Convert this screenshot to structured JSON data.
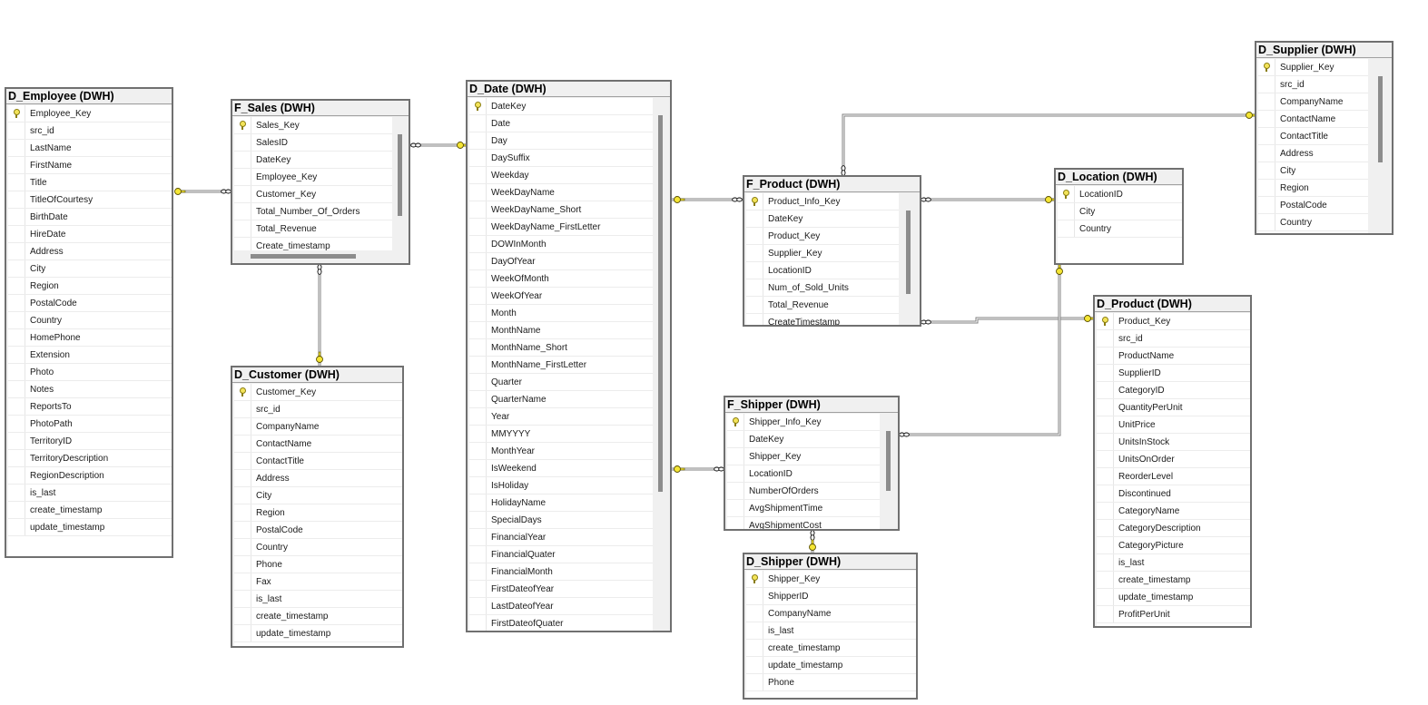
{
  "diagram": {
    "tables": {
      "d_employee": {
        "title": "D_Employee (DWH)",
        "primary_key": "Employee_Key",
        "columns": [
          "Employee_Key",
          "src_id",
          "LastName",
          "FirstName",
          "Title",
          "TitleOfCourtesy",
          "BirthDate",
          "HireDate",
          "Address",
          "City",
          "Region",
          "PostalCode",
          "Country",
          "HomePhone",
          "Extension",
          "Photo",
          "Notes",
          "ReportsTo",
          "PhotoPath",
          "TerritoryID",
          "TerritoryDescription",
          "RegionDescription",
          "is_last",
          "create_timestamp",
          "update_timestamp"
        ]
      },
      "f_sales": {
        "title": "F_Sales (DWH)",
        "primary_key": "Sales_Key",
        "columns": [
          "Sales_Key",
          "SalesID",
          "DateKey",
          "Employee_Key",
          "Customer_Key",
          "Total_Number_Of_Orders",
          "Total_Revenue",
          "Create_timestamp"
        ]
      },
      "d_customer": {
        "title": "D_Customer (DWH)",
        "primary_key": "Customer_Key",
        "columns": [
          "Customer_Key",
          "src_id",
          "CompanyName",
          "ContactName",
          "ContactTitle",
          "Address",
          "City",
          "Region",
          "PostalCode",
          "Country",
          "Phone",
          "Fax",
          "is_last",
          "create_timestamp",
          "update_timestamp"
        ]
      },
      "d_date": {
        "title": "D_Date (DWH)",
        "primary_key": "DateKey",
        "columns": [
          "DateKey",
          "Date",
          "Day",
          "DaySuffix",
          "Weekday",
          "WeekDayName",
          "WeekDayName_Short",
          "WeekDayName_FirstLetter",
          "DOWInMonth",
          "DayOfYear",
          "WeekOfMonth",
          "WeekOfYear",
          "Month",
          "MonthName",
          "MonthName_Short",
          "MonthName_FirstLetter",
          "Quarter",
          "QuarterName",
          "Year",
          "MMYYYY",
          "MonthYear",
          "IsWeekend",
          "IsHoliday",
          "HolidayName",
          "SpecialDays",
          "FinancialYear",
          "FinancialQuater",
          "FinancialMonth",
          "FirstDateofYear",
          "LastDateofYear",
          "FirstDateofQuater"
        ]
      },
      "f_product": {
        "title": "F_Product (DWH)",
        "primary_key": "Product_Info_Key",
        "columns": [
          "Product_Info_Key",
          "DateKey",
          "Product_Key",
          "Supplier_Key",
          "LocationID",
          "Num_of_Sold_Units",
          "Total_Revenue",
          "CreateTimestamp"
        ]
      },
      "f_shipper": {
        "title": "F_Shipper (DWH)",
        "primary_key": "Shipper_Info_Key",
        "columns": [
          "Shipper_Info_Key",
          "DateKey",
          "Shipper_Key",
          "LocationID",
          "NumberOfOrders",
          "AvgShipmentTime",
          "AvgShipmentCost"
        ]
      },
      "d_shipper": {
        "title": "D_Shipper (DWH)",
        "primary_key": "Shipper_Key",
        "columns": [
          "Shipper_Key",
          "ShipperID",
          "CompanyName",
          "is_last",
          "create_timestamp",
          "update_timestamp",
          "Phone"
        ]
      },
      "d_location": {
        "title": "D_Location (DWH)",
        "primary_key": "LocationID",
        "columns": [
          "LocationID",
          "City",
          "Country"
        ]
      },
      "d_supplier": {
        "title": "D_Supplier (DWH)",
        "primary_key": "Supplier_Key",
        "columns": [
          "Supplier_Key",
          "src_id",
          "CompanyName",
          "ContactName",
          "ContactTitle",
          "Address",
          "City",
          "Region",
          "PostalCode",
          "Country"
        ]
      },
      "d_product": {
        "title": "D_Product (DWH)",
        "primary_key": "Product_Key",
        "columns": [
          "Product_Key",
          "src_id",
          "ProductName",
          "SupplierID",
          "CategoryID",
          "QuantityPerUnit",
          "UnitPrice",
          "UnitsInStock",
          "UnitsOnOrder",
          "ReorderLevel",
          "Discontinued",
          "CategoryName",
          "CategoryDescription",
          "CategoryPicture",
          "is_last",
          "create_timestamp",
          "update_timestamp",
          "ProfitPerUnit"
        ]
      }
    },
    "relationships": [
      {
        "from": "f_sales",
        "to": "d_employee",
        "type": "many-to-one"
      },
      {
        "from": "f_sales",
        "to": "d_date",
        "type": "many-to-one"
      },
      {
        "from": "f_sales",
        "to": "d_customer",
        "type": "many-to-one"
      },
      {
        "from": "f_product",
        "to": "d_date",
        "type": "many-to-one"
      },
      {
        "from": "f_product",
        "to": "d_location",
        "type": "many-to-one"
      },
      {
        "from": "f_product",
        "to": "d_supplier",
        "type": "many-to-one"
      },
      {
        "from": "f_product",
        "to": "d_product",
        "type": "many-to-one"
      },
      {
        "from": "f_shipper",
        "to": "d_date",
        "type": "many-to-one"
      },
      {
        "from": "f_shipper",
        "to": "d_location",
        "type": "many-to-one"
      },
      {
        "from": "f_shipper",
        "to": "d_shipper",
        "type": "many-to-one"
      }
    ]
  }
}
